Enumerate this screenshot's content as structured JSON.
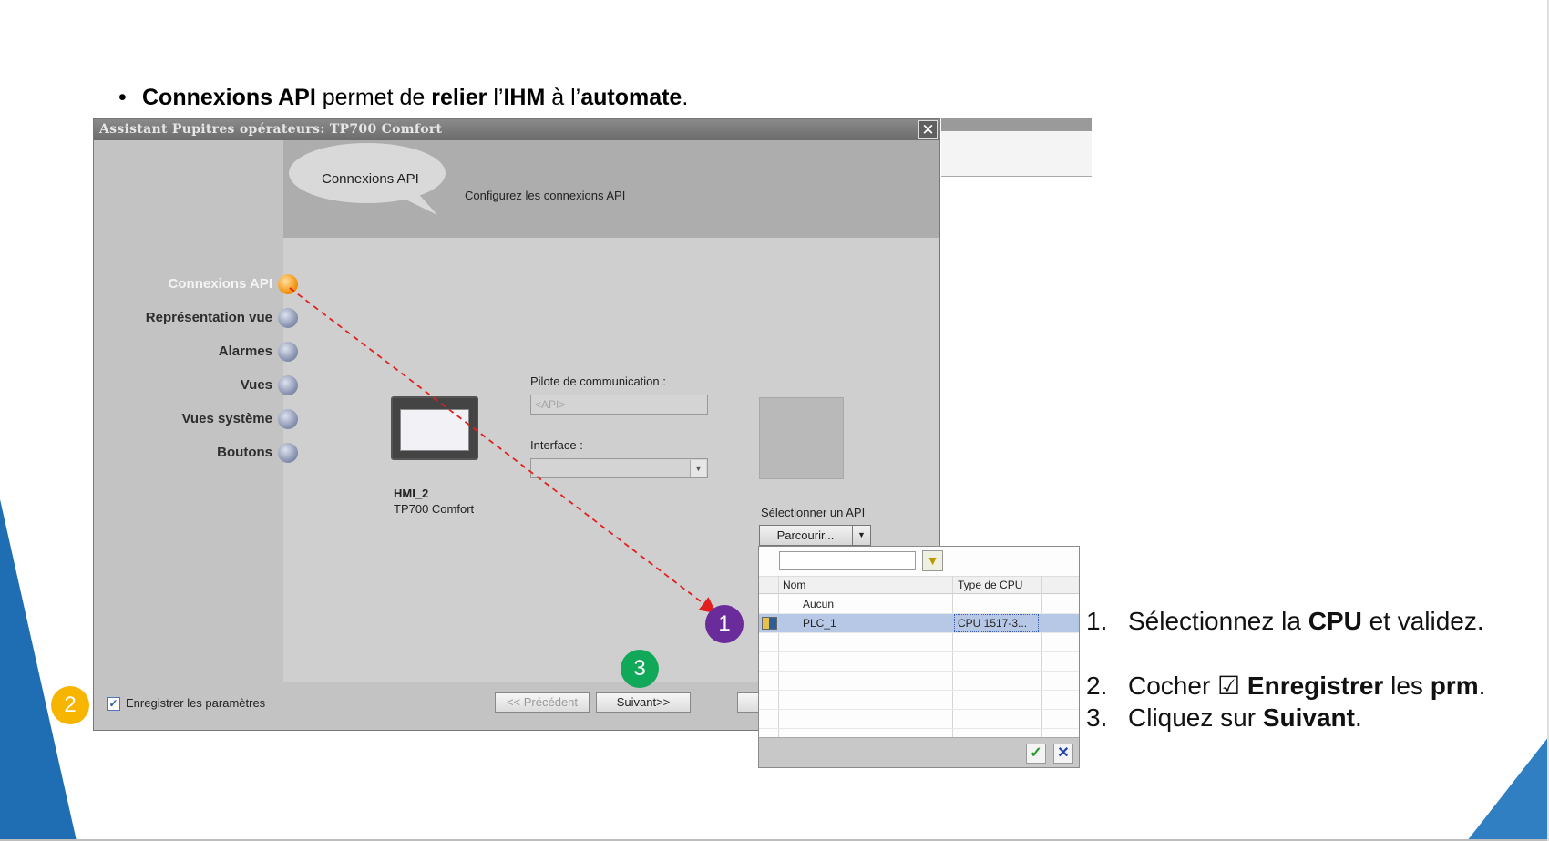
{
  "slide": {
    "bullet": {
      "dot": "•",
      "parts": [
        "Connexions API",
        " permet de ",
        "relier",
        " l’",
        "IHM",
        " à l’",
        "automate",
        "."
      ]
    },
    "instructions": [
      {
        "num": "1.",
        "pre": "Sélectionnez la ",
        "bold1": "CPU",
        "post": " et validez.",
        "bold2": "",
        "end": ""
      },
      {
        "num": "2.",
        "pre": "Cocher ☑ ",
        "bold1": "Enregistrer",
        "post": " les ",
        "bold2": "prm",
        "end": "."
      },
      {
        "num": "3.",
        "pre": "Cliquez sur ",
        "bold1": "Suivant",
        "post": ".",
        "bold2": "",
        "end": ""
      }
    ],
    "badges": {
      "one": "1",
      "two": "2",
      "three": "3"
    },
    "colors": {
      "badge_1": "#6a2c9a",
      "badge_2": "#f7b500",
      "badge_3": "#11a85a",
      "deco_blue": "#1f6db3",
      "connector": "#e02020"
    }
  },
  "wizard": {
    "title": "Assistant Pupitres opérateurs: TP700 Comfort",
    "close_icon": "close-icon",
    "header": {
      "title": "Connexions API",
      "subtitle": "Configurez les connexions API"
    },
    "steps": [
      {
        "label": "Connexions API",
        "active": true
      },
      {
        "label": "Représentation vue",
        "active": false
      },
      {
        "label": "Alarmes",
        "active": false
      },
      {
        "label": "Vues",
        "active": false
      },
      {
        "label": "Vues système",
        "active": false
      },
      {
        "label": "Boutons",
        "active": false
      }
    ],
    "hmi": {
      "name": "HMI_2",
      "model": "TP700 Comfort"
    },
    "pilote": {
      "label": "Pilote de communication :",
      "value": "<API>"
    },
    "interface": {
      "label": "Interface :",
      "value": ""
    },
    "select_api": {
      "label": "Sélectionner un API",
      "browse": "Parcourir..."
    },
    "footer": {
      "save_label": "Enregistrer les paramètres",
      "save_checked": true,
      "prev": "<< Précédent",
      "next": "Suivant>>"
    }
  },
  "dropdown": {
    "search_value": "",
    "columns": [
      "Nom",
      "Type de CPU"
    ],
    "rows": [
      {
        "name": "Aucun",
        "cpu": "",
        "selected": false
      },
      {
        "name": "PLC_1",
        "cpu": "CPU 1517-3...",
        "selected": true
      }
    ],
    "ok_icon": "check-icon",
    "cancel_icon": "cancel-icon",
    "filter_icon": "filter-icon"
  }
}
